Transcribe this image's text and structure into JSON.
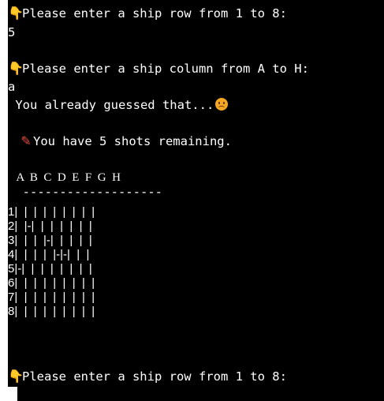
{
  "prompts": {
    "row_prompt": "Please enter a ship row from 1 to 8:",
    "row_answer": "5",
    "col_prompt": "Please enter a ship column from A to H:",
    "col_answer": "a",
    "already_guessed": " You already guessed that...",
    "shots_remaining": "You have 5 shots remaining.",
    "row_prompt_again": "Please enter a ship row from 1 to 8:"
  },
  "icons": {
    "hand": "pointing-hand-icon",
    "pencil": "crayon-icon",
    "frown": "frowning-face-icon"
  },
  "board": {
    "header": "   A  B  C  D  E  F  G  H",
    "separator": "  -------------------",
    "rows": [
      "1|  |  |  |  |  |  |  |  |",
      "2|  |-|  |  |  |  |  |  |",
      "3|  |  |  |-|  |  |  |  |",
      "4|  |  |  |  |-|-|  |  |",
      "5|-|  |  |  |  |  |  |  |",
      "6|  |  |  |  |  |  |  |  |",
      "7|  |  |  |  |  |  |  |  |",
      "8|  |  |  |  |  |  |  |  |"
    ]
  },
  "colors": {
    "background": "#000000",
    "text": "#ffffff",
    "emoji_hand": "#f5b933",
    "emoji_pencil": "#e84b3c"
  }
}
